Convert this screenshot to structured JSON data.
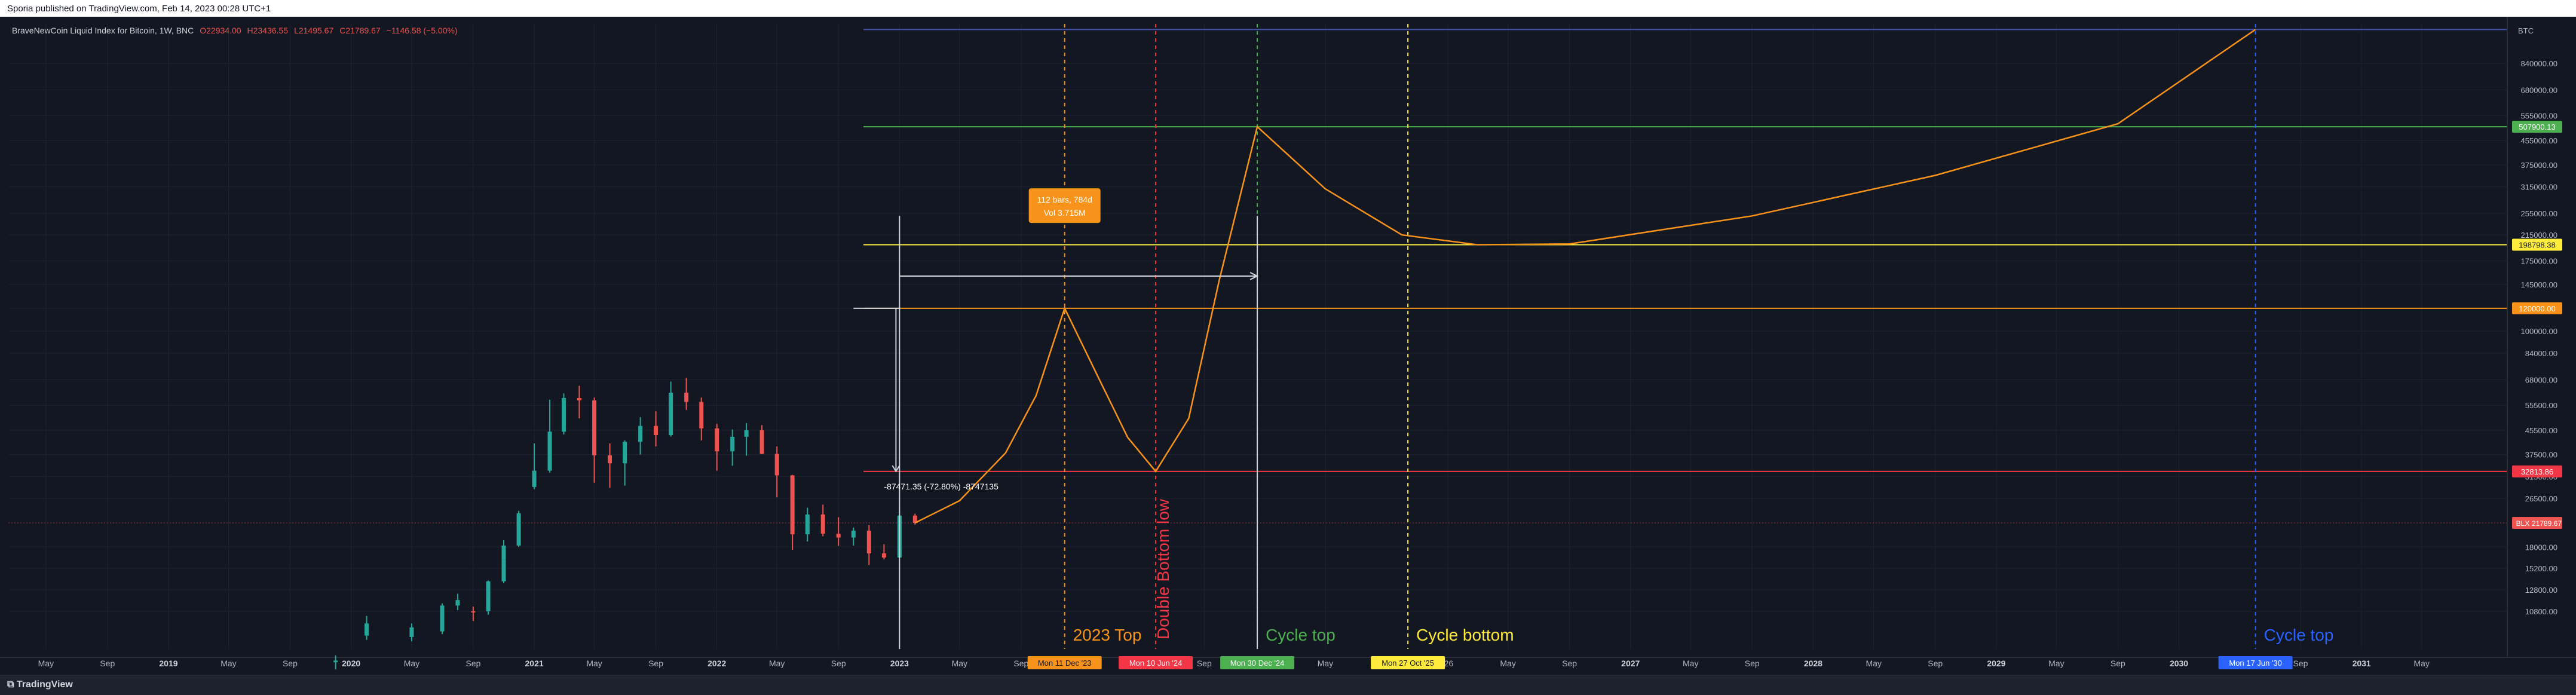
{
  "header": {
    "published": "Sporia published on TradingView.com, Feb 14, 2023 00:28 UTC+1"
  },
  "legend": {
    "symbol": "BraveNewCoin Liquid Index for Bitcoin, 1W, BNC",
    "o": "O22934.00",
    "h": "H23436.55",
    "l": "L21495.67",
    "c": "C21789.67",
    "chg": "−1146.58 (−5.00%)"
  },
  "footer": {
    "brand": "TradingView"
  },
  "colors": {
    "bg": "#131722",
    "grid": "#1f2330",
    "text": "#b2b5be",
    "up": "#26a69a",
    "down": "#ef5350",
    "orange": "#f7931a",
    "green": "#4caf50",
    "yellow": "#ffeb3b",
    "red": "#f23645",
    "blue": "#2962ff"
  },
  "chart_data": {
    "type": "candlestick",
    "y_scale": "log",
    "currency_label": "BTC",
    "ylim": [
      8000,
      1150000
    ],
    "price_ticks": [
      "840000.00",
      "680000.00",
      "555000.00",
      "455000.00",
      "375000.00",
      "315000.00",
      "255000.00",
      "215000.00",
      "175000.00",
      "145000.00",
      "120000.00",
      "100000.00",
      "84000.00",
      "68000.00",
      "55500.00",
      "45500.00",
      "37500.00",
      "31500.00",
      "26500.00",
      "18000.00",
      "15200.00",
      "12800.00",
      "10800.00"
    ],
    "time_ticks": [
      {
        "label": "May",
        "date": "2018-05",
        "bold": false
      },
      {
        "label": "Sep",
        "date": "2018-09",
        "bold": false
      },
      {
        "label": "2019",
        "date": "2019-01",
        "bold": true
      },
      {
        "label": "May",
        "date": "2019-05",
        "bold": false
      },
      {
        "label": "Sep",
        "date": "2019-09",
        "bold": false
      },
      {
        "label": "2020",
        "date": "2020-01",
        "bold": true
      },
      {
        "label": "May",
        "date": "2020-05",
        "bold": false
      },
      {
        "label": "Sep",
        "date": "2020-09",
        "bold": false
      },
      {
        "label": "2021",
        "date": "2021-01",
        "bold": true
      },
      {
        "label": "May",
        "date": "2021-05",
        "bold": false
      },
      {
        "label": "Sep",
        "date": "2021-09",
        "bold": false
      },
      {
        "label": "2022",
        "date": "2022-01",
        "bold": true
      },
      {
        "label": "May",
        "date": "2022-05",
        "bold": false
      },
      {
        "label": "Sep",
        "date": "2022-09",
        "bold": false
      },
      {
        "label": "2023",
        "date": "2023-01",
        "bold": true
      },
      {
        "label": "May",
        "date": "2023-05",
        "bold": false
      },
      {
        "label": "Sep",
        "date": "2023-09",
        "bold": false
      },
      {
        "label": "Sep",
        "date": "2024-09",
        "bold": false
      },
      {
        "label": "May",
        "date": "2025-05",
        "bold": false
      },
      {
        "label": "'26",
        "date": "2026-01",
        "bold": false
      },
      {
        "label": "May",
        "date": "2026-05",
        "bold": false
      },
      {
        "label": "Sep",
        "date": "2026-09",
        "bold": false
      },
      {
        "label": "2027",
        "date": "2027-01",
        "bold": true
      },
      {
        "label": "May",
        "date": "2027-05",
        "bold": false
      },
      {
        "label": "Sep",
        "date": "2027-09",
        "bold": false
      },
      {
        "label": "2028",
        "date": "2028-01",
        "bold": true
      },
      {
        "label": "May",
        "date": "2028-05",
        "bold": false
      },
      {
        "label": "Sep",
        "date": "2028-09",
        "bold": false
      },
      {
        "label": "2029",
        "date": "2029-01",
        "bold": true
      },
      {
        "label": "May",
        "date": "2029-05",
        "bold": false
      },
      {
        "label": "Sep",
        "date": "2029-09",
        "bold": false
      },
      {
        "label": "2030",
        "date": "2030-01",
        "bold": true
      },
      {
        "label": "Sep",
        "date": "2030-09",
        "bold": false
      },
      {
        "label": "2031",
        "date": "2031-01",
        "bold": true
      },
      {
        "label": "May",
        "date": "2031-05",
        "bold": false
      }
    ],
    "candles": [
      [
        "2019-12",
        7200,
        7600,
        6800,
        7300
      ],
      [
        "2020-02",
        8900,
        10400,
        8600,
        9800
      ],
      [
        "2020-05",
        8800,
        9800,
        8500,
        9500
      ],
      [
        "2020-07",
        9200,
        11500,
        9000,
        11300
      ],
      [
        "2020-08",
        11300,
        12400,
        10900,
        11800
      ],
      [
        "2020-09",
        10800,
        11200,
        10000,
        10700
      ],
      [
        "2020-10",
        10800,
        12300,
        10500,
        12200
      ],
      [
        "2020-10",
        12200,
        13800,
        12000,
        13700
      ],
      [
        "2020-11",
        13700,
        16500,
        13500,
        16300
      ],
      [
        "2020-11",
        16300,
        19000,
        15800,
        18200
      ],
      [
        "2020-12",
        18200,
        24000,
        18000,
        23500
      ],
      [
        "2021-01",
        29000,
        41000,
        28500,
        33000
      ],
      [
        "2021-02",
        33000,
        58000,
        32500,
        45000
      ],
      [
        "2021-03",
        45000,
        61000,
        44000,
        58800
      ],
      [
        "2021-04",
        58800,
        64800,
        50000,
        57700
      ],
      [
        "2021-05",
        57700,
        59000,
        30000,
        37300
      ],
      [
        "2021-06",
        37300,
        41000,
        28800,
        35000
      ],
      [
        "2021-07",
        35000,
        42000,
        29300,
        41500
      ],
      [
        "2021-08",
        41500,
        50500,
        37500,
        47100
      ],
      [
        "2021-09",
        47100,
        52900,
        40000,
        43800
      ],
      [
        "2021-10",
        43800,
        67000,
        43300,
        61300
      ],
      [
        "2021-11",
        61300,
        69000,
        53500,
        57000
      ],
      [
        "2021-12",
        57000,
        59000,
        42000,
        46200
      ],
      [
        "2022-01",
        46200,
        47900,
        33000,
        38500
      ],
      [
        "2022-02",
        38500,
        45800,
        34300,
        43200
      ],
      [
        "2022-03",
        43200,
        48200,
        37200,
        45500
      ],
      [
        "2022-04",
        45500,
        47400,
        37600,
        37700
      ],
      [
        "2022-05",
        37700,
        40000,
        26700,
        31800
      ],
      [
        "2022-06",
        31800,
        31900,
        17600,
        19900
      ],
      [
        "2022-07",
        19900,
        24600,
        18800,
        23300
      ],
      [
        "2022-08",
        23300,
        25200,
        19600,
        20000
      ],
      [
        "2022-09",
        20000,
        22800,
        18150,
        19400
      ],
      [
        "2022-10",
        19400,
        21000,
        18200,
        20500
      ],
      [
        "2022-11",
        20500,
        21400,
        15600,
        17100
      ],
      [
        "2022-12",
        17100,
        18400,
        16300,
        16550
      ],
      [
        "2023-01",
        16550,
        23900,
        16500,
        23100
      ],
      [
        "2023-02",
        23100,
        23450,
        21500,
        21790
      ]
    ],
    "last_price": "21789.67",
    "last_price_tag": "BLX",
    "horizontal_levels": [
      {
        "price": 1100000,
        "color": "#3f51b5",
        "label": ""
      },
      {
        "price": 507900,
        "color": "#4caf50",
        "label": "507900.13"
      },
      {
        "price": 198798,
        "color": "#ffeb3b",
        "label": "198798.38"
      },
      {
        "price": 120000,
        "color": "#f7931a",
        "label": "120000.00"
      },
      {
        "price": 32813,
        "color": "#f23645",
        "label": "32813.86"
      }
    ],
    "projection_path": [
      [
        "2023-02",
        21790
      ],
      [
        "2023-05",
        26000
      ],
      [
        "2023-08",
        38000
      ],
      [
        "2023-10",
        60000
      ],
      [
        "2023-12-11",
        120000
      ],
      [
        "2024-02",
        70000
      ],
      [
        "2024-04",
        43000
      ],
      [
        "2024-06-10",
        32813
      ],
      [
        "2024-08",
        50000
      ],
      [
        "2024-10",
        150000
      ],
      [
        "2024-12-30",
        507900
      ],
      [
        "2025-05",
        310000
      ],
      [
        "2025-10",
        215000
      ],
      [
        "2026-03",
        198798
      ],
      [
        "2026-09",
        200000
      ],
      [
        "2027-09",
        250000
      ],
      [
        "2028-09",
        345000
      ],
      [
        "2029-09",
        520000
      ],
      [
        "2030-06-17",
        1100000
      ]
    ],
    "events": [
      {
        "date": "2023-12-11",
        "label": "2023 Top",
        "tag": "Mon 11 Dec '23",
        "color": "#f7931a"
      },
      {
        "date": "2024-06-10",
        "label": "Double Bottom low",
        "tag": "Mon 10 Jun '24",
        "color": "#f23645"
      },
      {
        "date": "2024-12-30",
        "label": "Cycle top",
        "tag": "Mon 30 Dec '24",
        "color": "#4caf50"
      },
      {
        "date": "2025-10-27",
        "label": "Cycle bottom",
        "tag": "Mon 27 Oct '25",
        "color": "#ffeb3b"
      },
      {
        "date": "2030-06-17",
        "label": "Cycle top",
        "tag": "Mon 17 Jun '30",
        "color": "#2962ff"
      }
    ],
    "measure": {
      "text": "-87471.35 (-72.80%) -8747135",
      "from_price": 120000,
      "to_price": 32813,
      "date": "2022-12"
    },
    "range_box": {
      "line1": "112 bars, 784d",
      "line2": "Vol 3.715M"
    }
  }
}
